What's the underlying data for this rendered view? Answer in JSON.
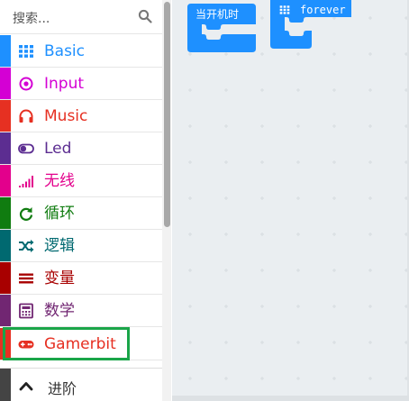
{
  "search": {
    "placeholder": "搜索..."
  },
  "categories": [
    {
      "label": "Basic",
      "color": "#1e90ff",
      "icon": "grid-icon"
    },
    {
      "label": "Input",
      "color": "#d400d4",
      "icon": "target-icon"
    },
    {
      "label": "Music",
      "color": "#e63022",
      "icon": "headphones-icon"
    },
    {
      "label": "Led",
      "color": "#5c2d91",
      "icon": "toggle-icon"
    },
    {
      "label": "无线",
      "color": "#e3008c",
      "icon": "signal-bars-icon"
    },
    {
      "label": "循环",
      "color": "#107c10",
      "icon": "refresh-icon"
    },
    {
      "label": "逻辑",
      "color": "#006970",
      "icon": "shuffle-icon"
    },
    {
      "label": "变量",
      "color": "#a80000",
      "icon": "list-icon"
    },
    {
      "label": "数学",
      "color": "#712672",
      "icon": "calculator-icon"
    },
    {
      "label": "Gamerbit",
      "color": "#e63022",
      "icon": "gamepad-icon"
    }
  ],
  "advanced": {
    "label": "进阶",
    "icon": "chevron-up-icon"
  },
  "blocks": [
    {
      "label": "当开机时",
      "color": "#1e90ff"
    },
    {
      "label": "forever",
      "color": "#1e90ff",
      "icon": "grid-icon"
    }
  ]
}
